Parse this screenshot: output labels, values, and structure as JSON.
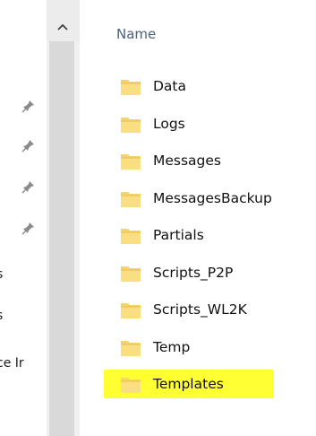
{
  "nav": {
    "items": [
      {
        "label": "s"
      },
      {
        "label": "s"
      },
      {
        "label": "ce Ir"
      }
    ],
    "pins": [
      "pin-icon",
      "pin-icon",
      "pin-icon",
      "pin-icon"
    ]
  },
  "scrollbar": {
    "up_icon": "chevron-up-icon"
  },
  "file_list": {
    "column_header": "Name",
    "folders": [
      {
        "name": "Data",
        "selected": false
      },
      {
        "name": "Logs",
        "selected": false
      },
      {
        "name": "Messages",
        "selected": false
      },
      {
        "name": "MessagesBackup",
        "selected": false
      },
      {
        "name": "Partials",
        "selected": false
      },
      {
        "name": "Scripts_P2P",
        "selected": false
      },
      {
        "name": "Scripts_WL2K",
        "selected": false
      },
      {
        "name": "Temp",
        "selected": false
      },
      {
        "name": "Templates",
        "selected": true
      }
    ],
    "selection_color": "#ffff33",
    "folder_color": "#f5d56b"
  }
}
